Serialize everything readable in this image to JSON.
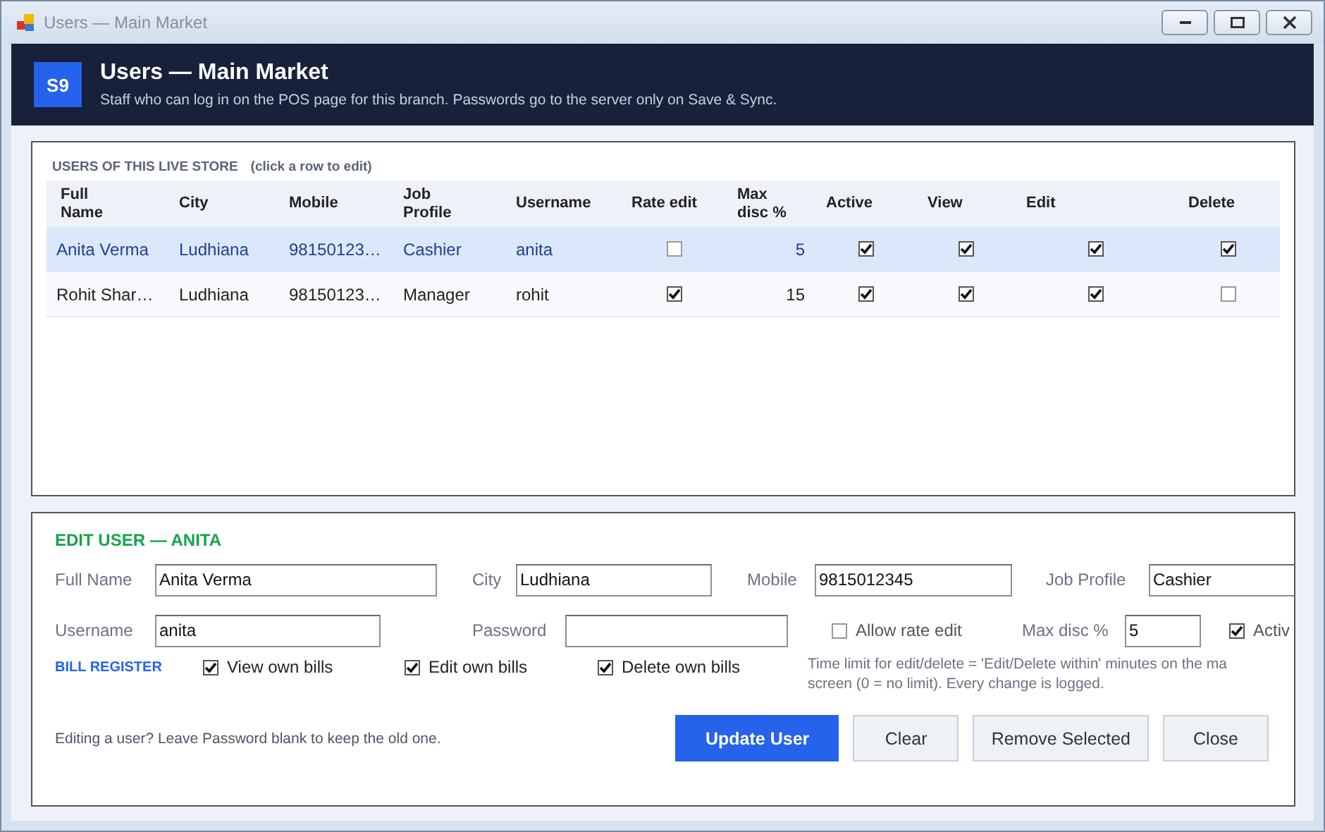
{
  "window": {
    "title": "Users — Main Market"
  },
  "header": {
    "badge": "S9",
    "title": "Users — Main Market",
    "subtitle": "Staff who can log in on the POS page for this branch. Passwords go to the server only on Save & Sync."
  },
  "users_panel": {
    "title": "USERS OF THIS LIVE STORE",
    "hint": "(click a row to edit)",
    "columns": [
      {
        "label": "Full Name",
        "kind": "text"
      },
      {
        "label": "City",
        "kind": "text"
      },
      {
        "label": "Mobile",
        "kind": "text"
      },
      {
        "label": "Job Profile",
        "kind": "text"
      },
      {
        "label": "Username",
        "kind": "text"
      },
      {
        "label": "Rate edit",
        "kind": "check"
      },
      {
        "label": "Max disc %",
        "kind": "number"
      },
      {
        "label": "Active",
        "kind": "check"
      },
      {
        "label": "View",
        "kind": "check"
      },
      {
        "label": "Edit",
        "kind": "check"
      },
      {
        "label": "Delete",
        "kind": "check"
      }
    ],
    "rows": [
      {
        "selected": true,
        "cells": [
          "Anita Verma",
          "Ludhiana",
          "98150123…",
          "Cashier",
          "anita",
          {
            "checked": false
          },
          "5",
          {
            "checked": true
          },
          {
            "checked": true
          },
          {
            "checked": true
          },
          {
            "checked": true
          }
        ]
      },
      {
        "selected": false,
        "cells": [
          "Rohit Shar…",
          "Ludhiana",
          "98150123…",
          "Manager",
          "rohit",
          {
            "checked": true
          },
          "15",
          {
            "checked": true
          },
          {
            "checked": true
          },
          {
            "checked": true
          },
          {
            "checked": false
          }
        ]
      }
    ]
  },
  "edit_panel": {
    "title": "EDIT USER — ANITA",
    "fields": [
      {
        "kind": "input",
        "label": "Full Name",
        "value": "Anita Verma"
      },
      {
        "kind": "input",
        "label": "City",
        "value": "Ludhiana"
      },
      {
        "kind": "input",
        "label": "Mobile",
        "value": "9815012345"
      },
      {
        "kind": "input",
        "label": "Job Profile",
        "value": "Cashier"
      },
      {
        "kind": "input",
        "label": "Username",
        "value": "anita"
      },
      {
        "kind": "input",
        "label": "Password"
      },
      {
        "kind": "checkbox",
        "label": "Allow rate edit",
        "checked": false
      },
      {
        "kind": "input",
        "label": "Max disc %",
        "value": "5"
      },
      {
        "kind": "checkbox",
        "label": "Activ",
        "checked": true
      },
      {
        "kind": "heading",
        "label": "BILL REGISTER"
      },
      {
        "kind": "checkbox",
        "label": "View own bills",
        "checked": true
      },
      {
        "kind": "checkbox",
        "label": "Edit own bills",
        "checked": true
      },
      {
        "kind": "checkbox",
        "label": "Delete own bills",
        "checked": true
      },
      {
        "kind": "note",
        "lines": [
          "Time limit for edit/delete = 'Edit/Delete within' minutes on the ma",
          "screen (0 = no limit). Every change is logged."
        ]
      }
    ],
    "footer_hint": "Editing a user? Leave Password blank to keep the old one.",
    "buttons": [
      {
        "label": "Update User",
        "kind": "primary"
      },
      {
        "label": "Clear",
        "kind": "secondary"
      },
      {
        "label": "Remove Selected",
        "kind": "secondary"
      },
      {
        "label": "Close",
        "kind": "secondary"
      }
    ]
  }
}
